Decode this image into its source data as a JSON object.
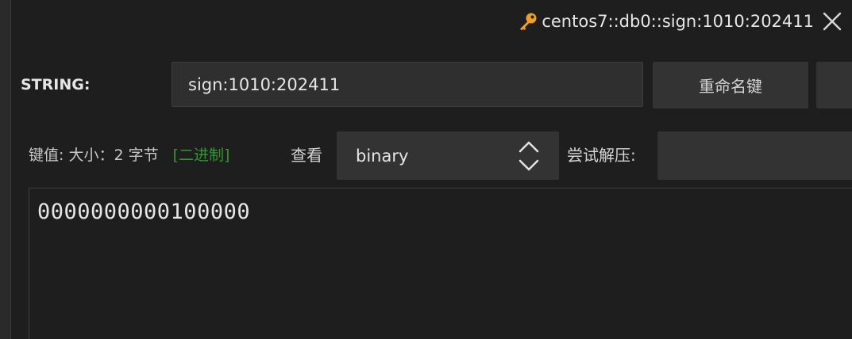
{
  "tab": {
    "title": "centos7::db0::sign:1010:202411",
    "key_icon": "key-icon",
    "key_icon_color": "#f0a020",
    "close_icon": "close-icon"
  },
  "key_row": {
    "type_label": "STRING:",
    "key_value": "sign:1010:202411",
    "rename_label": "重命名键"
  },
  "value_row": {
    "prefix": "键值:",
    "size_text": "大小：2 字节",
    "binary_tag": "[二进制]",
    "binary_tag_color": "#2e9a2e",
    "view_label": "查看",
    "view_selected": "binary",
    "decompress_label": "尝试解压:"
  },
  "value": {
    "content": "0000000000100000"
  }
}
